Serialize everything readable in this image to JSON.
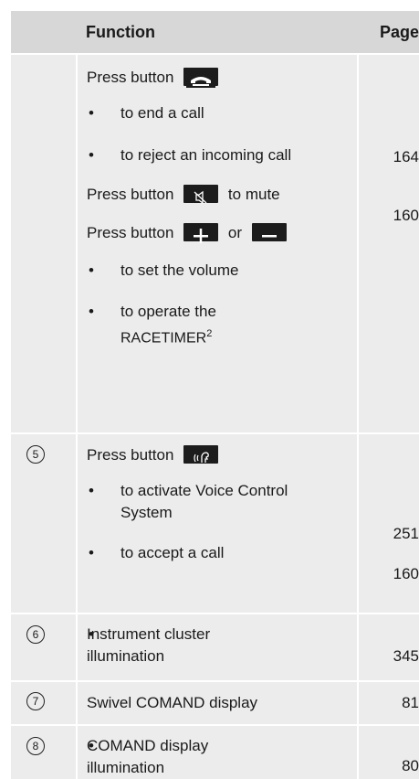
{
  "header": {
    "function": "Function",
    "page": "Page"
  },
  "group1": {
    "press_end": "Press button",
    "end_call": "to end a call",
    "end_call_page": "164",
    "reject_call": "to reject an incoming call",
    "reject_call_page": "160",
    "press_mute_pre": "Press button",
    "press_mute_post": "to mute",
    "press_vol_pre": "Press button",
    "press_vol_or": "or",
    "set_volume": "to set the volume",
    "racetimer_pre": "to operate the",
    "racetimer_word": "RACETIMER",
    "racetimer_note": "2"
  },
  "group5": {
    "num": "5",
    "press_voice": "Press button",
    "voice_control": "to activate Voice Control System",
    "voice_control_page": "251",
    "accept_call": "to accept a call",
    "accept_call_page": "160"
  },
  "group6": {
    "num": "6",
    "text": "Instrument cluster illumination",
    "page": "345"
  },
  "group7": {
    "num": "7",
    "text": "Swivel COMAND display",
    "page": "81"
  },
  "group8": {
    "num": "8",
    "text": "COMAND display illumination",
    "page": "80"
  },
  "icons": {
    "end_call": "phone-hangup-icon",
    "mute": "mute-speaker-icon",
    "plus": "plus-icon",
    "minus": "minus-icon",
    "voice": "voice-control-icon"
  }
}
